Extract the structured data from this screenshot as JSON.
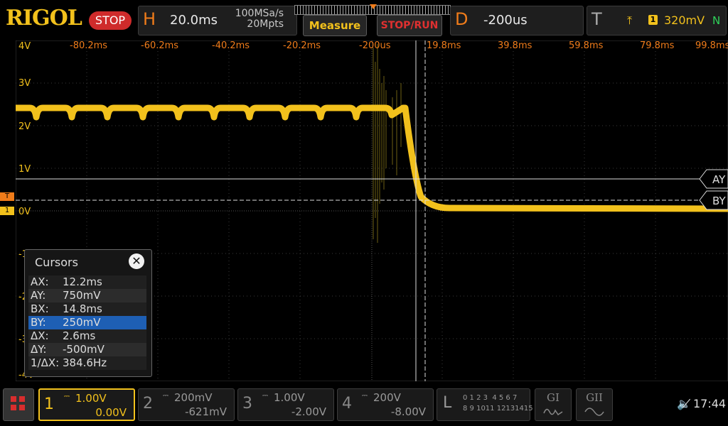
{
  "topbar": {
    "brand": "RIGOL",
    "run_state": "STOP",
    "horizontal": {
      "letter": "H",
      "timebase": "20.0ms",
      "sample_rate": "100MSa/s",
      "memory_depth": "20Mpts"
    },
    "measure_label": "Measure",
    "stop_run_label": "STOP/RUN",
    "delay": {
      "letter": "D",
      "value": "-200us"
    },
    "trigger": {
      "letter": "T",
      "slope_icon": "rising-edge-icon",
      "source": "1",
      "level": "320mV",
      "mode": "N"
    }
  },
  "time_labels": [
    "-80.2ms",
    "-60.2ms",
    "-40.2ms",
    "-20.2ms",
    "-200us",
    "19.8ms",
    "39.8ms",
    "59.8ms",
    "79.8ms",
    "99.8ms"
  ],
  "volt_labels": [
    "4V",
    "3V",
    "2V",
    "1V",
    "0V",
    "-1V",
    "-2V",
    "-3V",
    "-4V"
  ],
  "markers": {
    "trigger": "T",
    "ch1": "1"
  },
  "cursor_tags": {
    "ay": "AY",
    "by": "BY"
  },
  "cursors_panel": {
    "title": "Cursors",
    "close": "✕",
    "rows": [
      {
        "k": "AX:",
        "v": "12.2ms"
      },
      {
        "k": "AY:",
        "v": "750mV"
      },
      {
        "k": "BX:",
        "v": "14.8ms"
      },
      {
        "k": "BY:",
        "v": "250mV"
      },
      {
        "k": "ΔX:",
        "v": "2.6ms"
      },
      {
        "k": "ΔY:",
        "v": "-500mV"
      },
      {
        "k": "1/ΔX:",
        "v": "384.6Hz"
      }
    ]
  },
  "channels": [
    {
      "num": "1",
      "scale": "1.00V",
      "offset": "0.00V"
    },
    {
      "num": "2",
      "scale": "200mV",
      "offset": "-621mV"
    },
    {
      "num": "3",
      "scale": "1.00V",
      "offset": "-2.00V"
    },
    {
      "num": "4",
      "scale": "200V",
      "offset": "-8.00V"
    }
  ],
  "logic": {
    "label": "L",
    "row1": "0 1 2 3  4 5 6 7",
    "row2": "8 9 1011 12131415"
  },
  "gen1": "GI",
  "gen2": "GII",
  "clock": "17:44",
  "colors": {
    "ch1": "#f2c11c",
    "trigger": "#f07c1a",
    "selected_row": "#1e5fb4"
  }
}
